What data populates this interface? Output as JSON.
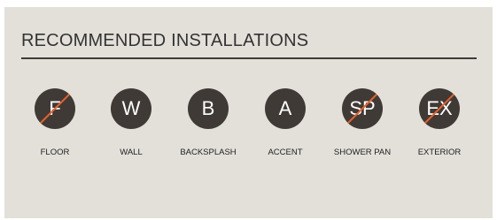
{
  "section": {
    "title": "RECOMMENDED INSTALLATIONS"
  },
  "colors": {
    "panel_background": "#e3e0d9",
    "circle_fill": "#3f3a36",
    "unavailable_slash": "#e8612c"
  },
  "installations": [
    {
      "abbr": "F",
      "label": "FLOOR",
      "recommended": false
    },
    {
      "abbr": "W",
      "label": "WALL",
      "recommended": true
    },
    {
      "abbr": "B",
      "label": "BACKSPLASH",
      "recommended": true
    },
    {
      "abbr": "A",
      "label": "ACCENT",
      "recommended": true
    },
    {
      "abbr": "SP",
      "label": "SHOWER PAN",
      "recommended": false
    },
    {
      "abbr": "EX",
      "label": "EXTERIOR",
      "recommended": false
    }
  ]
}
